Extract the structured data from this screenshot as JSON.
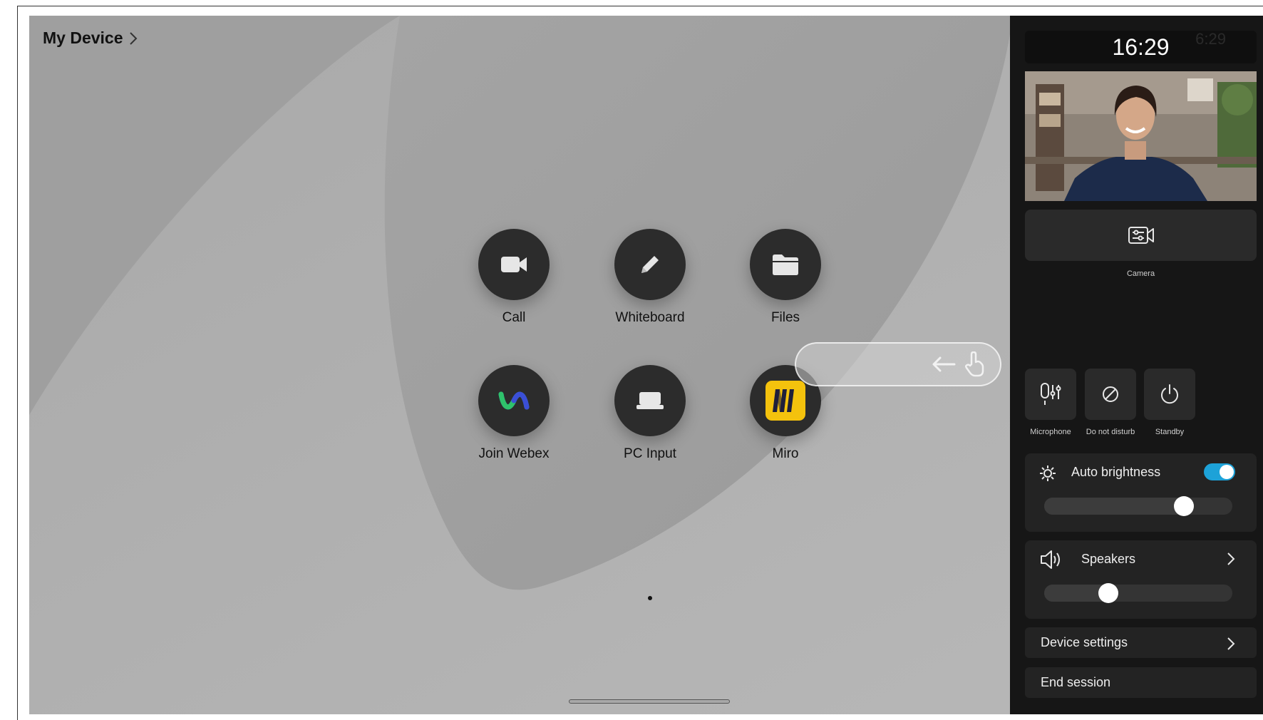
{
  "header": {
    "title": "My Device"
  },
  "apps": [
    {
      "id": "call",
      "label": "Call",
      "icon": "video-camera-icon"
    },
    {
      "id": "whiteboard",
      "label": "Whiteboard",
      "icon": "pencil-icon"
    },
    {
      "id": "files",
      "label": "Files",
      "icon": "folder-icon"
    },
    {
      "id": "webex",
      "label": "Join Webex",
      "icon": "webex-logo-icon"
    },
    {
      "id": "pc-input",
      "label": "PC Input",
      "icon": "laptop-icon"
    },
    {
      "id": "miro",
      "label": "Miro",
      "icon": "miro-logo-icon"
    }
  ],
  "panel": {
    "clock": "16:29",
    "clock_ghost": "6:29",
    "camera_label": "Camera",
    "quick_actions": [
      {
        "label": "Microphone",
        "icon": "microphone-settings-icon"
      },
      {
        "label": "Do not disturb",
        "icon": "do-not-disturb-icon"
      },
      {
        "label": "Standby",
        "icon": "power-icon"
      }
    ],
    "brightness": {
      "label": "Auto brightness",
      "auto": true,
      "level": 0.77
    },
    "speakers": {
      "label": "Speakers",
      "level": 0.32
    },
    "device_settings": "Device settings",
    "end_session": "End session"
  },
  "colors": {
    "panel_bg": "#161616",
    "button_bg": "#2a2a2a",
    "toggle_on": "#1da2d8",
    "miro_yellow": "#f4c20d",
    "screen_bg": "#9d9d9d"
  }
}
